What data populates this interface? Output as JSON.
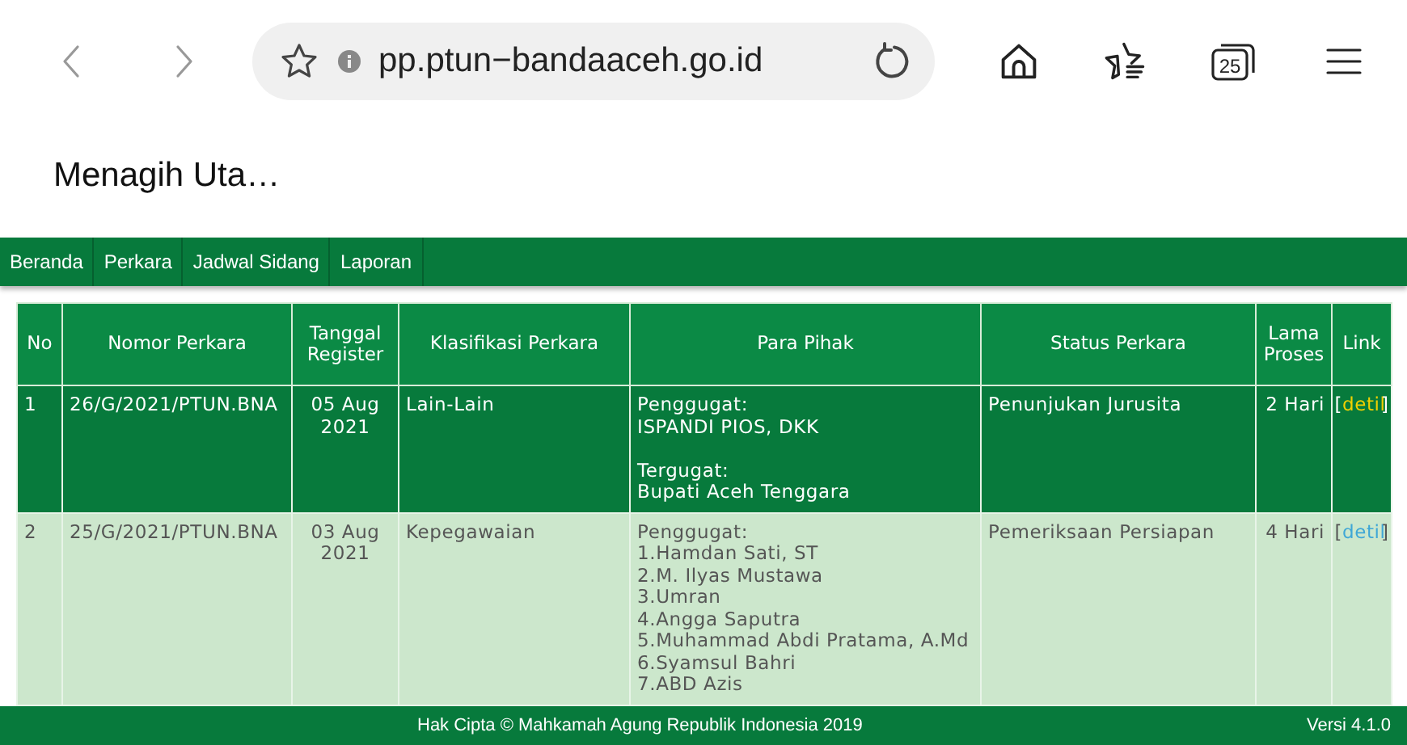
{
  "browser": {
    "url": "pp.ptun−bandaaceh.go.id",
    "tab_count": "25"
  },
  "page_title": "Menagih Uta…",
  "nav": [
    "Beranda",
    "Perkara",
    "Jadwal Sidang",
    "Laporan"
  ],
  "table": {
    "columns": [
      "No",
      "Nomor Perkara",
      "Tanggal Register",
      "Klasifikasi Perkara",
      "Para Pihak",
      "Status Perkara",
      "Lama Proses",
      "Link"
    ],
    "rows": [
      {
        "selected": true,
        "no": "1",
        "nomor": "26/G/2021/PTUN.BNA",
        "tanggal": "05 Aug 2021",
        "klasifikasi": "Lain-Lain",
        "pihak": [
          {
            "role": "Penggugat:",
            "names": [
              "ISPANDI PIOS, DKK"
            ]
          },
          {
            "role": "Tergugat:",
            "names": [
              "Bupati Aceh Tenggara"
            ]
          }
        ],
        "status": "Penunjukan Jurusita",
        "lama": "2 Hari",
        "link": {
          "open": "[",
          "label": "detil",
          "close": "]"
        }
      },
      {
        "selected": false,
        "no": "2",
        "nomor": "25/G/2021/PTUN.BNA",
        "tanggal": "03 Aug 2021",
        "klasifikasi": "Kepegawaian",
        "pihak": [
          {
            "role": "Penggugat:",
            "names": [
              "1.Hamdan Sati, ST",
              "2.M. Ilyas Mustawa",
              "3.Umran",
              "4.Angga Saputra",
              "5.Muhammad Abdi Pratama, A.Md",
              "6.Syamsul Bahri",
              "7.ABD Azis"
            ]
          }
        ],
        "status": "Pemeriksaan Persiapan",
        "lama": "4 Hari",
        "link": {
          "open": "[",
          "label": "detil",
          "close": "]"
        }
      }
    ]
  },
  "footer": {
    "copyright": "Hak Cipta © Mahkamah Agung Republik Indonesia 2019",
    "version": "Versi 4.1.0"
  }
}
